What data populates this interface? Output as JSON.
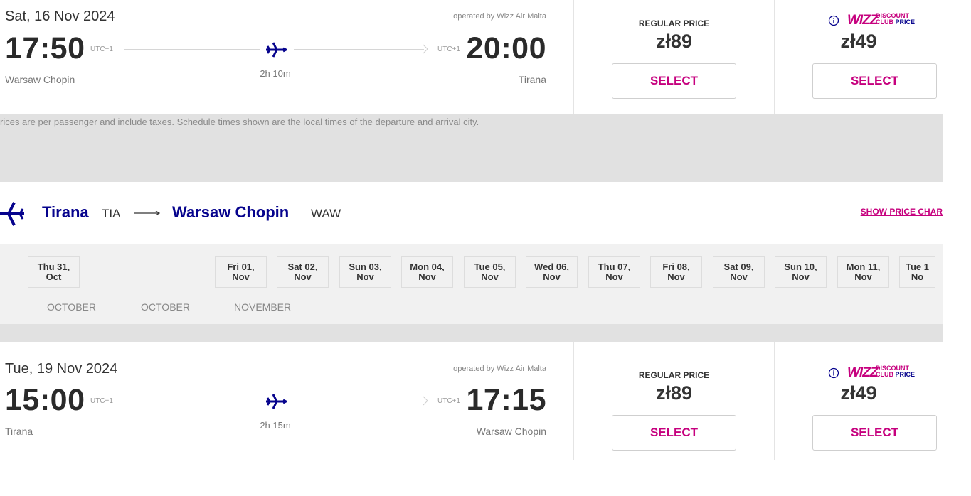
{
  "flight1": {
    "date": "Sat, 16 Nov 2024",
    "operated_by": "operated by Wizz Air Malta",
    "dep_time": "17:50",
    "dep_tz": "UTC+1",
    "arr_time": "20:00",
    "arr_tz": "UTC+1",
    "duration": "2h 10m",
    "dep_city": "Warsaw Chopin",
    "arr_city": "Tirana",
    "regular_label": "REGULAR PRICE",
    "regular_price": "zł89",
    "club_logo": "WIZZ",
    "club_line1": "DISCOUNT",
    "club_line2a": "CLUB",
    "club_line2b": "PRICE",
    "club_price": "zł49",
    "select_label": "SELECT"
  },
  "notice": "rices are per passenger and include taxes. Schedule times shown are the local times of the departure and arrival city.",
  "route": {
    "from_city": "Tirana",
    "from_code": "TIA",
    "to_city": "Warsaw Chopin",
    "to_code": "WAW",
    "price_chart_link": "SHOW PRICE CHAR"
  },
  "date_selector": {
    "prev_icon": "chevron-left-icon",
    "dates": [
      {
        "line1": "Thu 31,",
        "line2": "Oct"
      },
      {
        "line1": "Fri 01,",
        "line2": "Nov"
      },
      {
        "line1": "Sat 02,",
        "line2": "Nov"
      },
      {
        "line1": "Sun 03,",
        "line2": "Nov"
      },
      {
        "line1": "Mon 04,",
        "line2": "Nov"
      },
      {
        "line1": "Tue 05,",
        "line2": "Nov"
      },
      {
        "line1": "Wed 06,",
        "line2": "Nov"
      },
      {
        "line1": "Thu 07,",
        "line2": "Nov"
      },
      {
        "line1": "Fri 08,",
        "line2": "Nov"
      },
      {
        "line1": "Sat 09,",
        "line2": "Nov"
      },
      {
        "line1": "Sun 10,",
        "line2": "Nov"
      },
      {
        "line1": "Mon 11,",
        "line2": "Nov"
      },
      {
        "line1": "Tue 1",
        "line2": "No"
      }
    ],
    "months": [
      "OCTOBER",
      "OCTOBER",
      "NOVEMBER"
    ]
  },
  "flight2": {
    "date": "Tue, 19 Nov 2024",
    "operated_by": "operated by Wizz Air Malta",
    "dep_time": "15:00",
    "dep_tz": "UTC+1",
    "arr_time": "17:15",
    "arr_tz": "UTC+1",
    "duration": "2h 15m",
    "dep_city": "Tirana",
    "arr_city": "Warsaw Chopin",
    "regular_label": "REGULAR PRICE",
    "regular_price": "zł89",
    "club_logo": "WIZZ",
    "club_line1": "DISCOUNT",
    "club_line2a": "CLUB",
    "club_line2b": "PRICE",
    "club_price": "zł49",
    "select_label": "SELECT"
  },
  "colors": {
    "brand_magenta": "#c6007e",
    "brand_navy": "#06038d",
    "band_grey": "#e1e1e1"
  }
}
